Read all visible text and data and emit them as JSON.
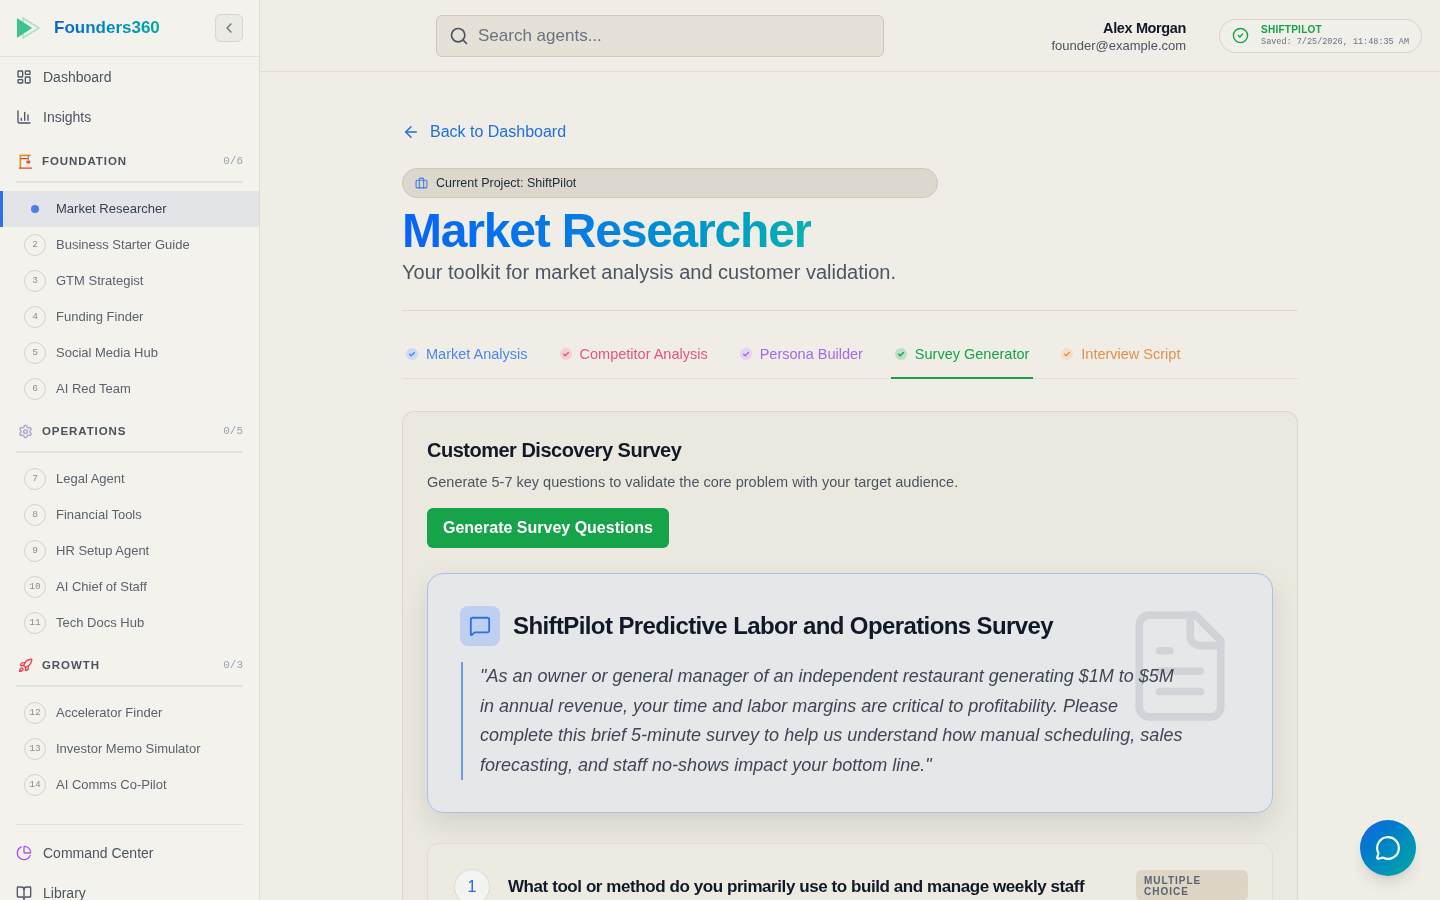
{
  "sidebar": {
    "brand": "Founders360",
    "nav": [
      {
        "label": "Dashboard"
      },
      {
        "label": "Insights"
      }
    ],
    "sections": [
      {
        "title": "FOUNDATION",
        "count": "0/6",
        "items": [
          {
            "label": "Market Researcher",
            "selected": true
          },
          {
            "number": "2",
            "label": "Business Starter Guide",
            "selected": false
          },
          {
            "number": "3",
            "label": "GTM Strategist",
            "selected": false
          },
          {
            "number": "4",
            "label": "Funding Finder",
            "selected": false
          },
          {
            "number": "5",
            "label": "Social Media Hub",
            "selected": false
          },
          {
            "number": "6",
            "label": "AI Red Team",
            "selected": false
          }
        ]
      },
      {
        "title": "OPERATIONS",
        "count": "0/5",
        "items": [
          {
            "number": "7",
            "label": "Legal Agent",
            "selected": false
          },
          {
            "number": "8",
            "label": "Financial Tools",
            "selected": false
          },
          {
            "number": "9",
            "label": "HR Setup Agent",
            "selected": false
          },
          {
            "number": "10",
            "label": "AI Chief of Staff",
            "selected": false
          },
          {
            "number": "11",
            "label": "Tech Docs Hub",
            "selected": false
          }
        ]
      },
      {
        "title": "GROWTH",
        "count": "0/3",
        "items": [
          {
            "number": "12",
            "label": "Accelerator Finder",
            "selected": false
          },
          {
            "number": "13",
            "label": "Investor Memo Simulator",
            "selected": false
          },
          {
            "number": "14",
            "label": "AI Comms Co-Pilot",
            "selected": false
          }
        ]
      }
    ],
    "footer_nav": [
      {
        "label": "Command Center"
      },
      {
        "label": "Library"
      }
    ]
  },
  "header": {
    "search": {
      "placeholder": "Search agents..."
    },
    "user": {
      "name": "Alex Morgan",
      "email": "founder@example.com"
    },
    "save_status": {
      "project": "SHIFTPILOT",
      "saved": "Saved: 7/25/2026, 11:48:35 AM"
    }
  },
  "main": {
    "back_link": "Back to Dashboard",
    "project_pill": "Current Project: ShiftPilot",
    "title": "Market Researcher",
    "subtitle": "Your toolkit for market analysis and customer validation.",
    "tabs": [
      {
        "label": "Market Analysis",
        "color": "#4a88e8",
        "selected": false
      },
      {
        "label": "Competitor Analysis",
        "color": "#e2577a",
        "selected": false
      },
      {
        "label": "Persona Builder",
        "color": "#a56ae6",
        "selected": false
      },
      {
        "label": "Survey Generator",
        "color": "#16a34a",
        "selected": true
      },
      {
        "label": "Interview Script",
        "color": "#df914c",
        "selected": false
      }
    ],
    "tool_card": {
      "title": "Customer Discovery Survey",
      "description": "Generate 5-7 key questions to validate the core problem with your target audience.",
      "button": "Generate Survey Questions",
      "survey": {
        "title": "ShiftPilot Predictive Labor and Operations Survey",
        "intro": "\"As an owner or general manager of an independent restaurant generating $1M to $5M in annual revenue, your time and labor margins are critical to profitability. Please complete this brief 5-minute survey to help us understand how manual scheduling, sales forecasting, and staff no-shows impact your bottom line.\""
      },
      "questions": [
        {
          "number": "1",
          "text": "What tool or method do you primarily use to build and manage weekly staff",
          "type": "MULTIPLE CHOICE"
        }
      ]
    }
  }
}
